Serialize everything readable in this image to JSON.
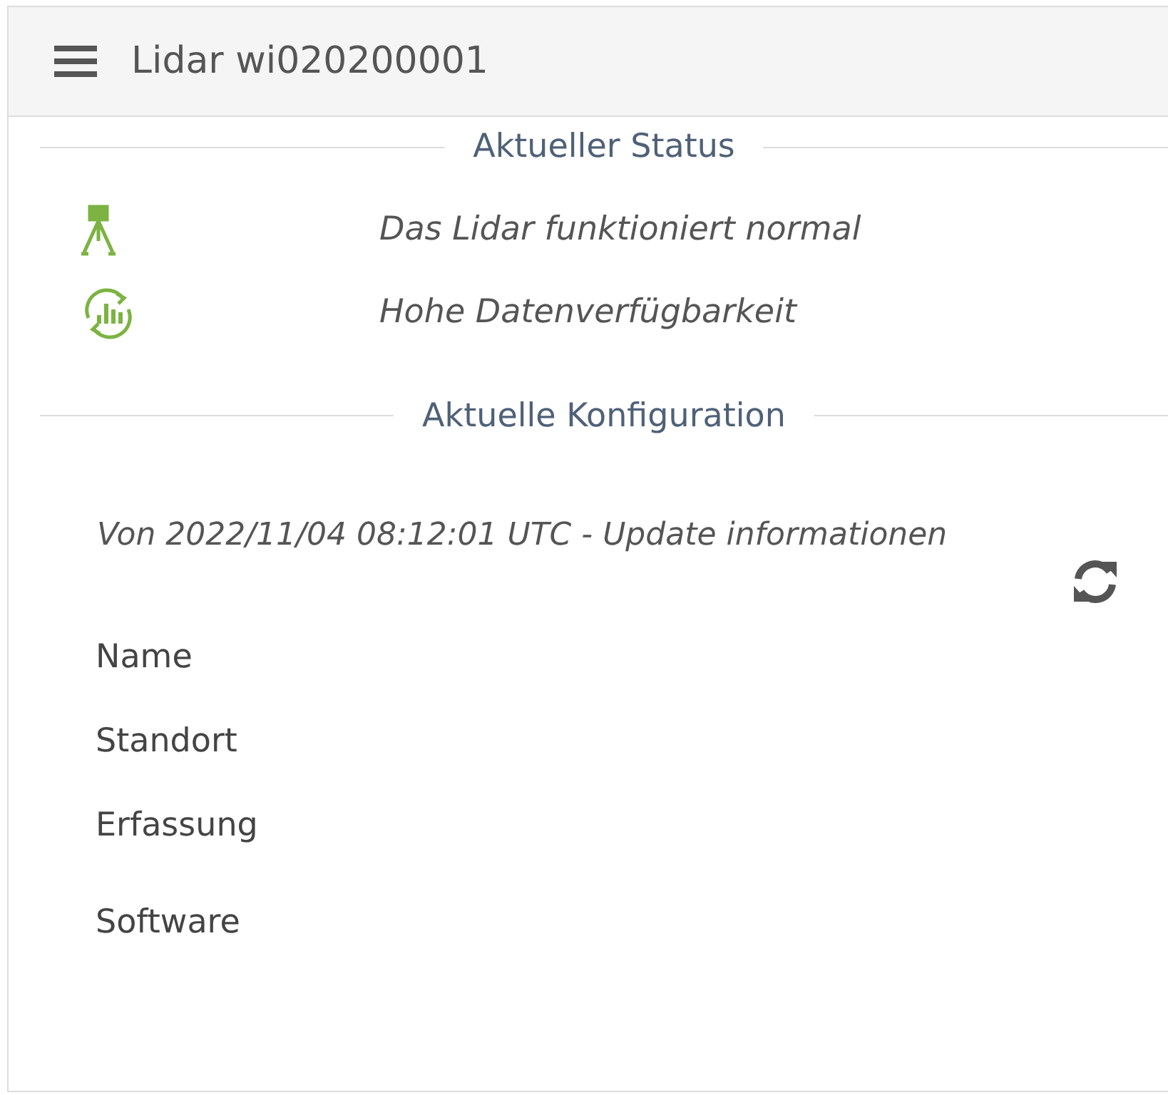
{
  "header": {
    "title": "Lidar wi020200001"
  },
  "status": {
    "heading": "Aktueller Status",
    "items": [
      {
        "kind": "device",
        "text": "Das Lidar funktioniert normal"
      },
      {
        "kind": "data",
        "text": "Hohe Datenverfügbarkeit"
      }
    ]
  },
  "configuration": {
    "heading": "Aktuelle Konfiguration",
    "updated": "Von 2022/11/04 08:12:01 UTC - Update informationen",
    "fields": [
      "Name",
      "Standort",
      "Erfassung",
      "Software"
    ]
  }
}
